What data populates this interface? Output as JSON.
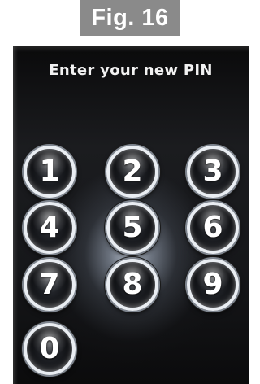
{
  "figure": {
    "label": "Fig. 16"
  },
  "screen": {
    "prompt": "Enter your new PIN"
  },
  "keypad": {
    "keys": [
      "1",
      "2",
      "3",
      "4",
      "5",
      "6",
      "7",
      "8",
      "9",
      "0"
    ]
  }
}
